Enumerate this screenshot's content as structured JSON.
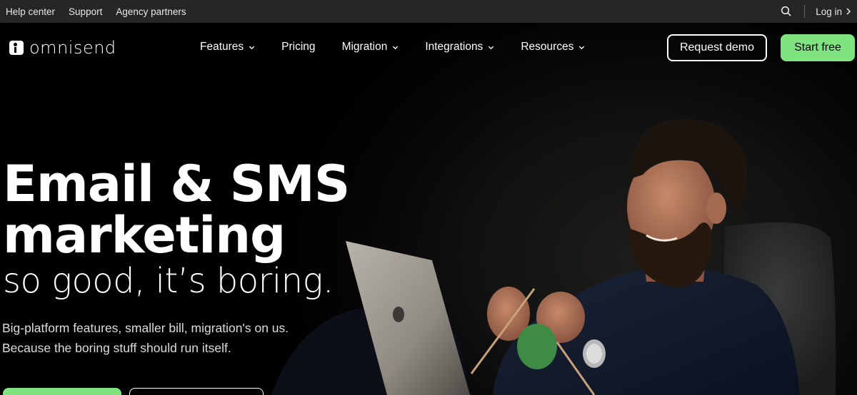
{
  "topbar": {
    "links": [
      "Help center",
      "Support",
      "Agency partners"
    ],
    "login": "Log in"
  },
  "nav": {
    "brand": "omnisend",
    "menu": [
      {
        "label": "Features",
        "dropdown": true
      },
      {
        "label": "Pricing",
        "dropdown": false
      },
      {
        "label": "Migration",
        "dropdown": true
      },
      {
        "label": "Integrations",
        "dropdown": true
      },
      {
        "label": "Resources",
        "dropdown": true
      }
    ],
    "request_demo": "Request demo",
    "start_free": "Start free"
  },
  "hero": {
    "headline_line1": "Email & SMS",
    "headline_line2": "marketing",
    "tagline": "so good, it’s boring.",
    "sub_line1": "Big-platform features, smaller bill, migration's on us.",
    "sub_line2": "Because the boring stuff should run itself."
  },
  "colors": {
    "accent_green": "#7fe47f",
    "topbar_bg": "#262626",
    "page_bg": "#000000"
  },
  "icons": {
    "search": "search-icon",
    "login_arrow": "chevron-right-icon",
    "dropdown": "chevron-down-icon"
  }
}
